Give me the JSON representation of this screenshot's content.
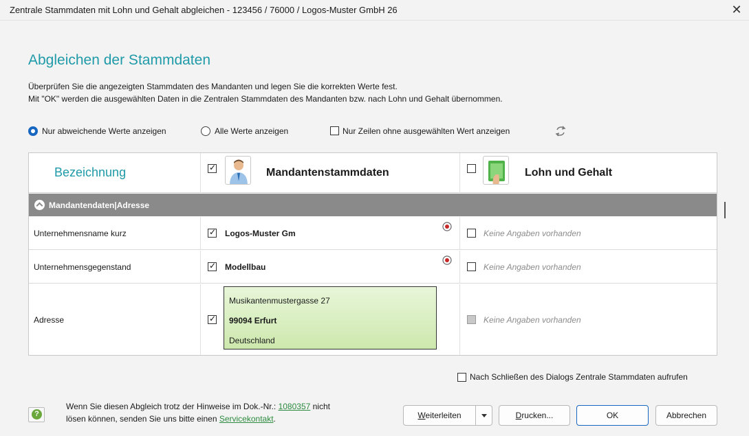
{
  "window": {
    "title": "Zentrale Stammdaten mit Lohn und Gehalt abgleichen -  123456 / 76000 / Logos-Muster GmbH 26",
    "close_glyph": "✕"
  },
  "heading": "Abgleichen der Stammdaten",
  "description": {
    "line1": "Überprüfen Sie die angezeigten Stammdaten des Mandanten und legen Sie die korrekten Werte fest.",
    "line2": "Mit \"OK\" werden die ausgewählten Daten in die Zentralen Stammdaten des Mandanten bzw. nach Lohn und Gehalt übernommen."
  },
  "filters": {
    "radio_diff_label": "Nur abweichende Werte anzeigen",
    "radio_diff_selected": true,
    "radio_all_label": "Alle Werte anzeigen",
    "radio_all_selected": false,
    "checkbox_unselected_label": "Nur Zeilen ohne ausgewählten Wert anzeigen",
    "checkbox_unselected_checked": false,
    "refresh_icon": "refresh-icon"
  },
  "grid": {
    "header": {
      "bezeichnung": "Bezeichnung",
      "col1_label": "Mandantenstammdaten",
      "col1_checked": true,
      "col1_icon": "person-icon",
      "col2_label": "Lohn und Gehalt",
      "col2_checked": false,
      "col2_icon": "money-icon"
    },
    "group": {
      "label": "Mandantendaten|Adresse",
      "icon": "collapse-icon"
    },
    "rows": [
      {
        "name": "Unternehmensname kurz",
        "value": "Logos-Muster Gm",
        "checked": true,
        "other": "Keine Angaben vorhanden",
        "other_checked": false
      },
      {
        "name": "Unternehmensgegenstand",
        "value": "Modellbau",
        "checked": true,
        "other": "Keine Angaben vorhanden",
        "other_checked": false
      },
      {
        "name": "Adresse",
        "address": [
          "Musikantenmustergasse 27",
          "99094 Erfurt",
          "Deutschland"
        ],
        "checked": true,
        "other": "Keine Angaben vorhanden",
        "other_checked": false
      }
    ]
  },
  "after_close": {
    "label": "Nach Schließen des Dialogs Zentrale Stammdaten aufrufen",
    "checked": false
  },
  "hint": {
    "line1_prefix": "Wenn Sie diesen Abgleich trotz der Hinweise im Dok.-Nr.: ",
    "doc_nr": "1080357",
    "line1_suffix": " nicht",
    "line2_prefix": "lösen können, senden Sie uns bitte einen ",
    "service_link": "Servicekontakt",
    "line2_suffix": "."
  },
  "buttons": {
    "forward_underline": "W",
    "forward_rest": "eiterleiten",
    "print_underline": "D",
    "print_rest": "rucken...",
    "ok": "OK",
    "cancel": "Abbrechen"
  }
}
